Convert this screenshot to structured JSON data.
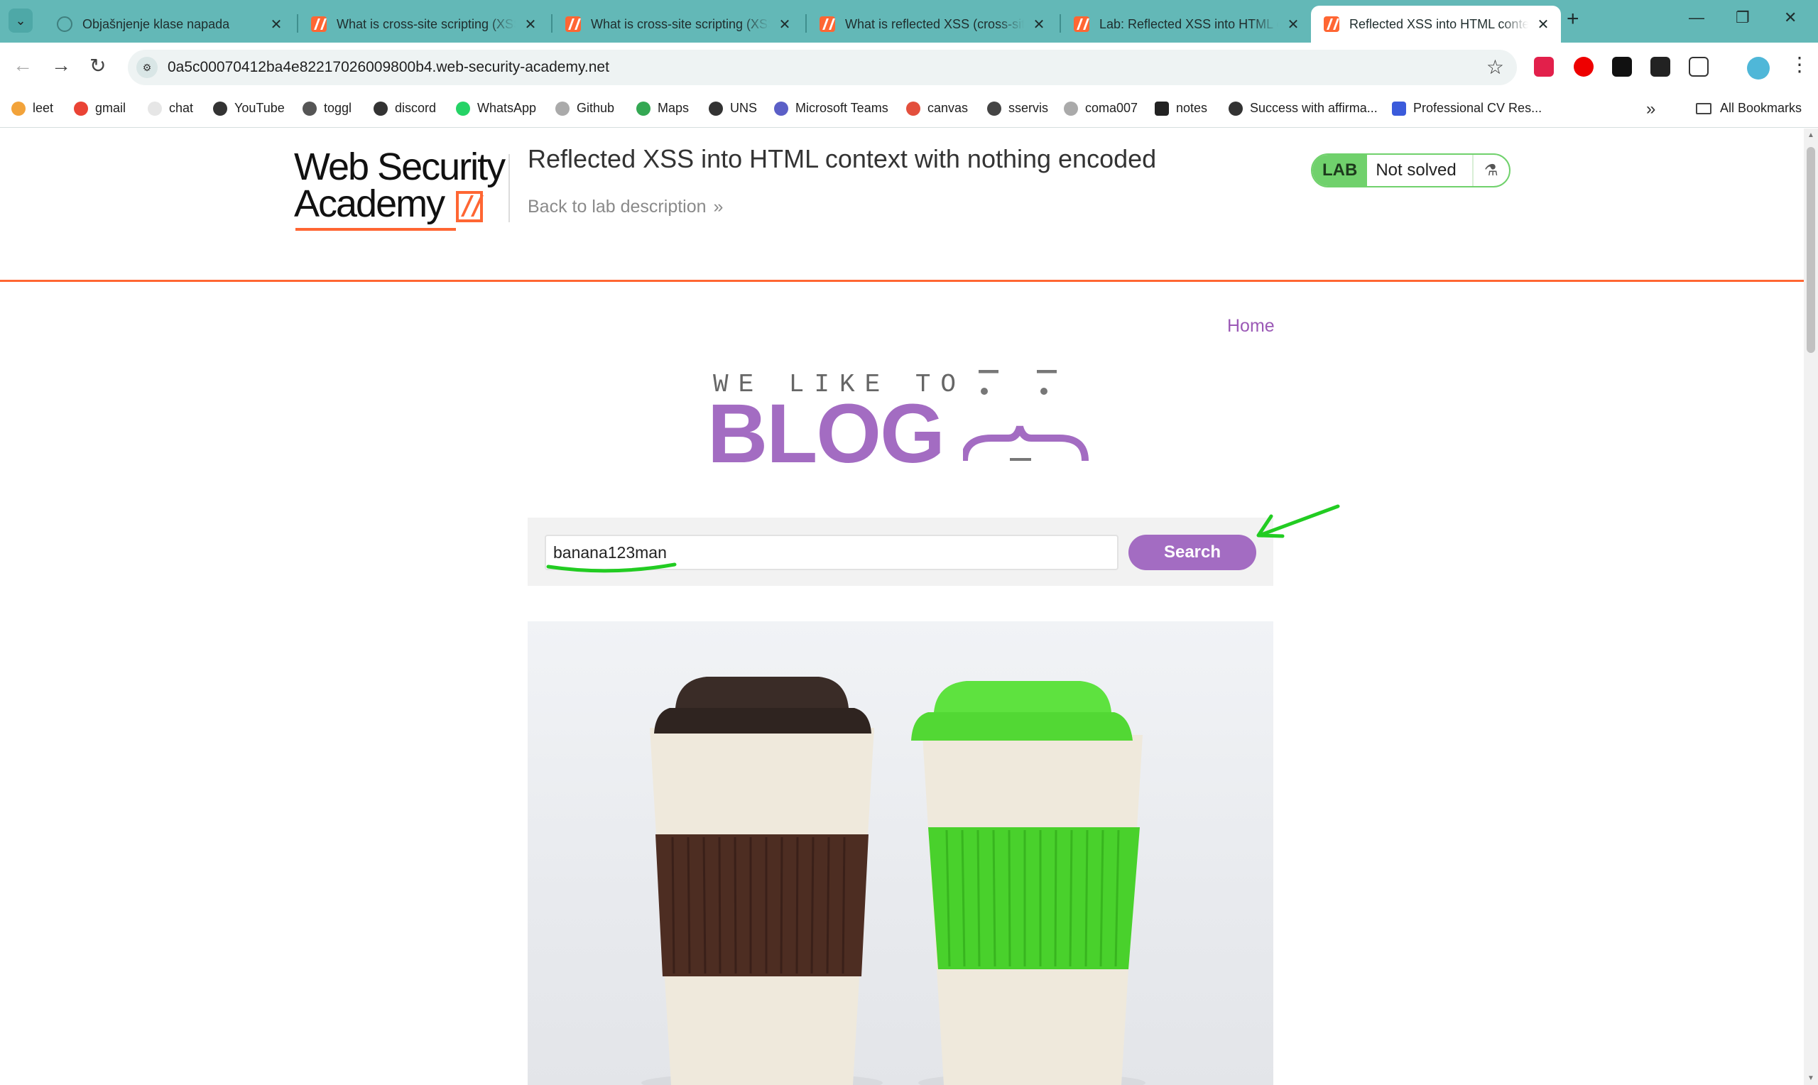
{
  "browser": {
    "tabs": [
      {
        "title": "Objašnjenje klase napada",
        "icon": "chatgpt-icon"
      },
      {
        "title": "What is cross-site scripting (XSS)",
        "icon": "portswigger-icon"
      },
      {
        "title": "What is cross-site scripting (XSS)",
        "icon": "portswigger-icon"
      },
      {
        "title": "What is reflected XSS (cross-site",
        "icon": "portswigger-icon"
      },
      {
        "title": "Lab: Reflected XSS into HTML c",
        "icon": "portswigger-icon"
      },
      {
        "title": "Reflected XSS into HTML context",
        "icon": "portswigger-icon",
        "active": true
      }
    ],
    "url": "0a5c00070412ba4e82217026009800b4.web-security-academy.net",
    "bookmarks": [
      {
        "label": "leet",
        "color": "#f2a33a"
      },
      {
        "label": "gmail",
        "color": "#ea4335"
      },
      {
        "label": "chat",
        "color": "#9aa0a6"
      },
      {
        "label": "YouTube",
        "color": "#333333"
      },
      {
        "label": "toggl",
        "color": "#555555"
      },
      {
        "label": "discord",
        "color": "#333333"
      },
      {
        "label": "WhatsApp",
        "color": "#25d366"
      },
      {
        "label": "Github",
        "color": "#aaaaaa"
      },
      {
        "label": "Maps",
        "color": "#34a853"
      },
      {
        "label": "UNS",
        "color": "#333333"
      },
      {
        "label": "Microsoft Teams",
        "color": "#5b5fc7"
      },
      {
        "label": "canvas",
        "color": "#e34f3d"
      },
      {
        "label": "sservis",
        "color": "#444444"
      },
      {
        "label": "coma007",
        "color": "#aaaaaa"
      },
      {
        "label": "notes",
        "color": "#222222"
      },
      {
        "label": "Success with affirma...",
        "color": "#333333"
      },
      {
        "label": "Professional CV Res...",
        "color": "#3b5bdb"
      }
    ],
    "all_bookmarks": "All Bookmarks"
  },
  "academy": {
    "logo_line1": "Web Security",
    "logo_line2": "Academy",
    "lab_title": "Reflected XSS into HTML context with nothing encoded",
    "back_link": "Back to lab description",
    "badge_label": "LAB",
    "badge_status": "Not solved"
  },
  "blog": {
    "home_link": "Home",
    "logo_top": "WE LIKE TO",
    "logo_main": "BLOG",
    "search_value": "banana123man",
    "search_button": "Search"
  },
  "colors": {
    "accent": "#a36cc2",
    "academy_orange": "#ff6633",
    "lab_green": "#70d16c",
    "annotation_green": "#22cc22"
  }
}
